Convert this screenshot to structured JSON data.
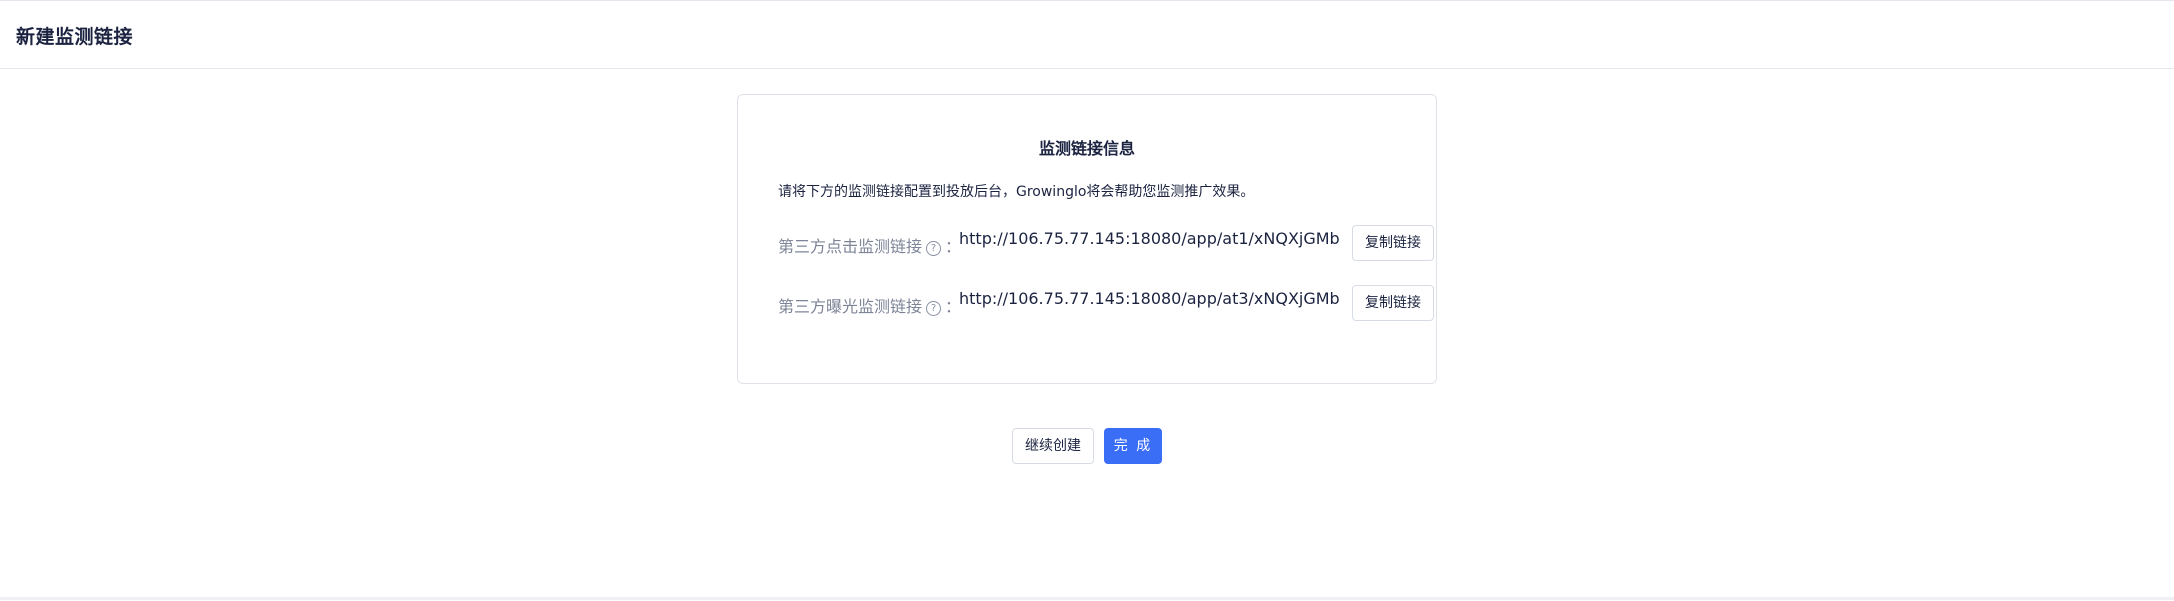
{
  "header": {
    "title": "新建监测链接"
  },
  "card": {
    "title": "监测链接信息",
    "description": "请将下方的监测链接配置到投放后台，Growinglo将会帮助您监测推广效果。",
    "help_glyph": "?",
    "colon": "：",
    "rows": [
      {
        "label": "第三方点击监测链接",
        "url": "http://106.75.77.145:18080/app/at1/xNQXjGMb",
        "copy_label": "复制链接"
      },
      {
        "label": "第三方曝光监测链接",
        "url": "http://106.75.77.145:18080/app/at3/xNQXjGMb",
        "copy_label": "复制链接"
      }
    ]
  },
  "actions": {
    "continue_label": "继续创建",
    "done_label": "完 成"
  },
  "colors": {
    "primary": "#3b6ef6",
    "text": "#1b2340",
    "muted": "#7d8497",
    "border": "#dfe2e8"
  },
  "icons": {
    "help": "question-circle-icon"
  }
}
